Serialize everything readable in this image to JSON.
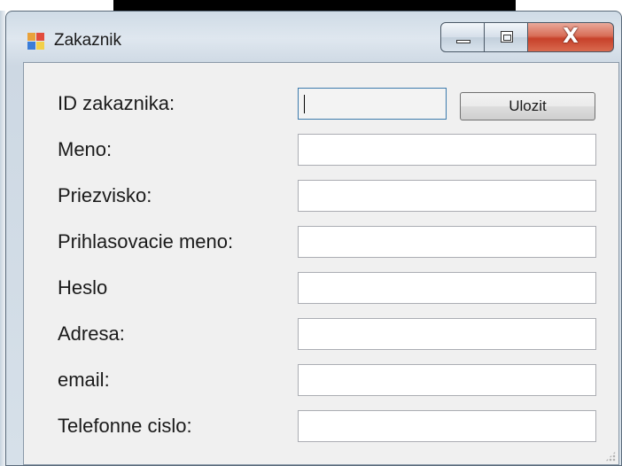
{
  "window": {
    "title": "Zakaznik",
    "icon": "app-form-icon",
    "close_glyph": "X"
  },
  "form": {
    "fields": [
      {
        "label": "ID zakaznika:",
        "value": ""
      },
      {
        "label": "Meno:",
        "value": ""
      },
      {
        "label": "Priezvisko:",
        "value": ""
      },
      {
        "label": "Prihlasovacie meno:",
        "value": ""
      },
      {
        "label": "Heslo",
        "value": ""
      },
      {
        "label": "Adresa:",
        "value": ""
      },
      {
        "label": "email:",
        "value": ""
      },
      {
        "label": "Telefonne cislo:",
        "value": ""
      }
    ],
    "save_label": "Ulozit"
  }
}
